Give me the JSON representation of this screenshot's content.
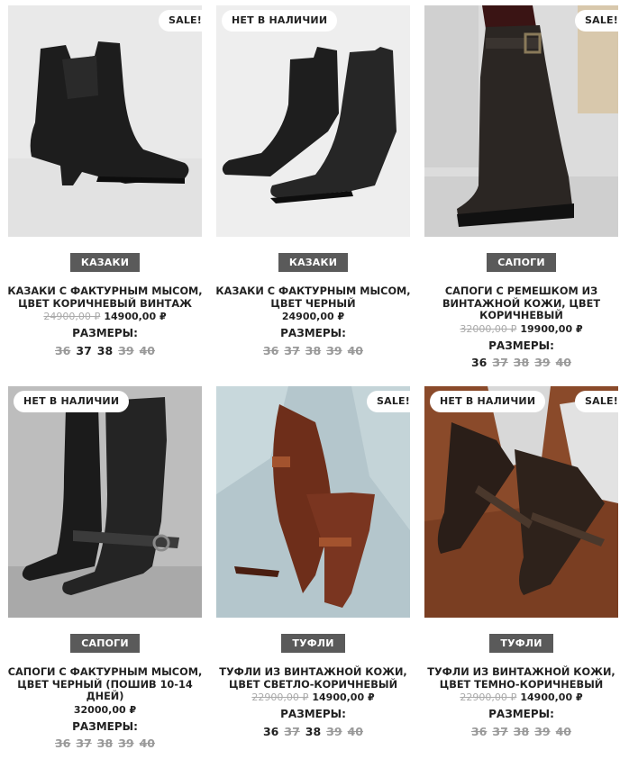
{
  "products": [
    {
      "badge": "SALE!",
      "badge_type": "sale",
      "category": "КАЗАКИ",
      "title": "КАЗАКИ С ФАКТУРНЫМ МЫСОМ, ЦВЕТ КОРИЧНЕВЫЙ ВИНТАЖ",
      "old_price": "24900,00 ₽",
      "price": "14900,00 ₽",
      "sizes_label": "Размеры:",
      "sizes": [
        {
          "v": "36",
          "available": false
        },
        {
          "v": "37",
          "available": true
        },
        {
          "v": "38",
          "available": true
        },
        {
          "v": "39",
          "available": false
        },
        {
          "v": "40",
          "available": false
        }
      ]
    },
    {
      "badge": "НЕТ В НАЛИЧИИ",
      "badge_type": "stock",
      "category": "КАЗАКИ",
      "title": "КАЗАКИ С ФАКТУРНЫМ МЫСОМ, ЦВЕТ ЧЕРНЫЙ",
      "old_price": "",
      "price": "24900,00 ₽",
      "sizes_label": "Размеры:",
      "sizes": [
        {
          "v": "36",
          "available": false
        },
        {
          "v": "37",
          "available": false
        },
        {
          "v": "38",
          "available": false
        },
        {
          "v": "39",
          "available": false
        },
        {
          "v": "40",
          "available": false
        }
      ]
    },
    {
      "badge": "SALE!",
      "badge_type": "sale",
      "category": "САПОГИ",
      "title": "САПОГИ С РЕМЕШКОМ ИЗ ВИНТАЖНОЙ КОЖИ, ЦВЕТ КОРИЧНЕВЫЙ",
      "old_price": "32000,00 ₽",
      "price": "19900,00 ₽",
      "sizes_label": "Размеры:",
      "sizes": [
        {
          "v": "36",
          "available": true
        },
        {
          "v": "37",
          "available": false
        },
        {
          "v": "38",
          "available": false
        },
        {
          "v": "39",
          "available": false
        },
        {
          "v": "40",
          "available": false
        }
      ]
    },
    {
      "badge": "НЕТ В НАЛИЧИИ",
      "badge_type": "stock",
      "category": "САПОГИ",
      "title": "САПОГИ С ФАКТУРНЫМ МЫСОМ, ЦВЕТ ЧЕРНЫЙ (ПОШИВ 10-14 ДНЕЙ)",
      "old_price": "",
      "price": "32000,00 ₽",
      "sizes_label": "Размеры:",
      "sizes": [
        {
          "v": "36",
          "available": false
        },
        {
          "v": "37",
          "available": false
        },
        {
          "v": "38",
          "available": false
        },
        {
          "v": "39",
          "available": false
        },
        {
          "v": "40",
          "available": false
        }
      ]
    },
    {
      "badge": "SALE!",
      "badge_type": "sale",
      "category": "ТУФЛИ",
      "title": "ТУФЛИ ИЗ ВИНТАЖНОЙ КОЖИ, ЦВЕТ СВЕТЛО-КОРИЧНЕВЫЙ",
      "old_price": "22900,00 ₽",
      "price": "14900,00 ₽",
      "sizes_label": "Размеры:",
      "sizes": [
        {
          "v": "36",
          "available": true
        },
        {
          "v": "37",
          "available": false
        },
        {
          "v": "38",
          "available": true
        },
        {
          "v": "39",
          "available": false
        },
        {
          "v": "40",
          "available": false
        }
      ]
    },
    {
      "badge": "НЕТ В НАЛИЧИИ",
      "badge_type": "stock",
      "badge2": "SALE!",
      "category": "ТУФЛИ",
      "title": "ТУФЛИ ИЗ ВИНТАЖНОЙ КОЖИ, ЦВЕТ ТЕМНО-КОРИЧНЕВЫЙ",
      "old_price": "22900,00 ₽",
      "price": "14900,00 ₽",
      "sizes_label": "Размеры:",
      "sizes": [
        {
          "v": "36",
          "available": false
        },
        {
          "v": "37",
          "available": false
        },
        {
          "v": "38",
          "available": false
        },
        {
          "v": "39",
          "available": false
        },
        {
          "v": "40",
          "available": false
        }
      ]
    }
  ],
  "colors": {
    "category_bg": "#5a5a5a",
    "unavailable_size": "#999999",
    "old_price": "#aaaaaa"
  }
}
